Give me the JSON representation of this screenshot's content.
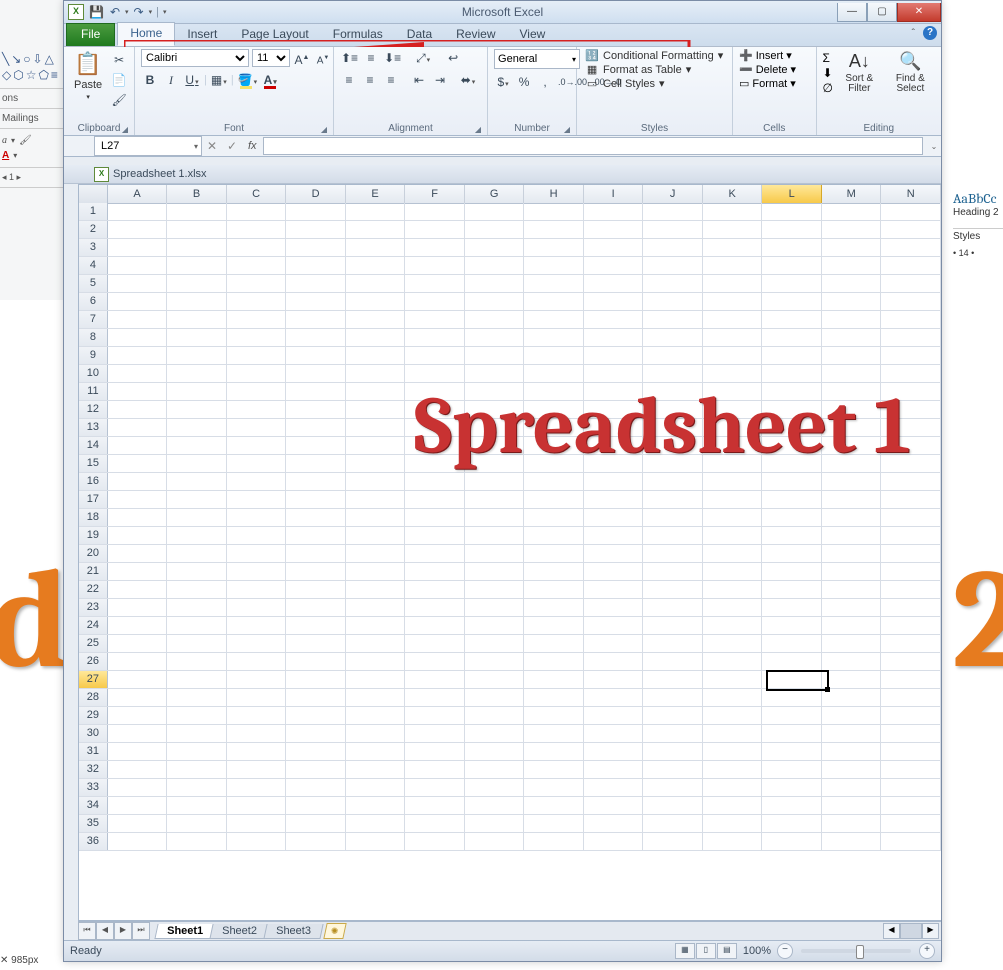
{
  "app_title": "Microsoft Excel",
  "qat": {
    "save": "💾",
    "undo": "↶",
    "redo": "↷"
  },
  "tabs": {
    "file": "File",
    "items": [
      "Home",
      "Insert",
      "Page Layout",
      "Formulas",
      "Data",
      "Review",
      "View"
    ],
    "active": "Home"
  },
  "ribbon": {
    "clipboard": {
      "label": "Clipboard",
      "paste": "Paste",
      "cut": "✂",
      "copy": "📄",
      "format_painter": "🖌"
    },
    "font": {
      "label": "Font",
      "name": "Calibri",
      "size": "11",
      "bold": "B",
      "italic": "I",
      "underline": "U"
    },
    "alignment": {
      "label": "Alignment"
    },
    "number": {
      "label": "Number",
      "format": "General"
    },
    "styles": {
      "label": "Styles",
      "conditional": "Conditional Formatting",
      "table": "Format as Table",
      "cell": "Cell Styles"
    },
    "cells": {
      "label": "Cells",
      "insert": "Insert",
      "delete": "Delete",
      "format": "Format"
    },
    "editing": {
      "label": "Editing",
      "sort": "Sort & Filter",
      "find": "Find & Select"
    }
  },
  "name_box": "L27",
  "doc_title": "Spreadsheet 1.xlsx",
  "columns": [
    "A",
    "B",
    "C",
    "D",
    "E",
    "F",
    "G",
    "H",
    "I",
    "J",
    "K",
    "L",
    "M",
    "N"
  ],
  "selected_column": "L",
  "row_count": 36,
  "selected_row": 27,
  "overlay_text": "Spreadsheet 1",
  "sheets": {
    "tabs": [
      "Sheet1",
      "Sheet2",
      "Sheet3"
    ],
    "active": "Sheet1"
  },
  "status": {
    "ready": "Ready",
    "zoom": "100%"
  },
  "background": {
    "letter_left": "d",
    "letter_right": "2",
    "heading_preview": "AaBbCc",
    "heading_label": "Heading 2",
    "styles_label": "Styles",
    "bullets_hint": "• 14 •",
    "dim": "985px",
    "mailings": "Mailings",
    "ons": "ons"
  }
}
